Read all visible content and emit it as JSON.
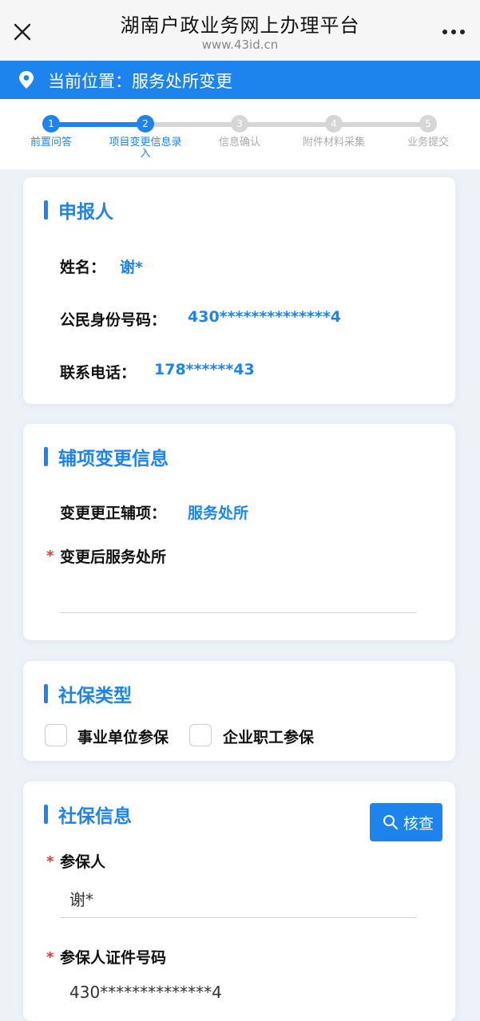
{
  "window": {
    "title": "湖南户政业务网上办理平台",
    "url": "www.43id.cn",
    "close_icon": "close-icon",
    "more_icon": "more-icon"
  },
  "location": {
    "icon": "location-pin-icon",
    "text": "当前位置：服务处所变更"
  },
  "colors": {
    "accent": "#1d84ee",
    "required": "#e53935",
    "inactive": "#d6d6d6"
  },
  "steps": [
    {
      "num": "1",
      "label": "前置问答",
      "active": true
    },
    {
      "num": "2",
      "label": "项目变更信息录入",
      "active": true
    },
    {
      "num": "3",
      "label": "信息确认",
      "active": false
    },
    {
      "num": "4",
      "label": "附件材料采集",
      "active": false
    },
    {
      "num": "5",
      "label": "业务提交",
      "active": false
    }
  ],
  "applicant": {
    "title": "申报人",
    "name_label": "姓名：",
    "name_value": "谢*",
    "id_label": "公民身份号码：",
    "id_value": "430**************4",
    "phone_label": "联系电话：",
    "phone_value": "178******43"
  },
  "aux_change": {
    "title": "辅项变更信息",
    "item_label": "变更更正辅项：",
    "item_value": "服务处所",
    "required_mark": "*",
    "new_address_label": "变更后服务处所",
    "new_address_value": ""
  },
  "insurance_type": {
    "title": "社保类型",
    "options": [
      "事业单位参保",
      "企业职工参保"
    ]
  },
  "insurance_info": {
    "title": "社保信息",
    "check_button": "核查",
    "check_icon": "search-icon",
    "required_mark": "*",
    "insured_label": "参保人",
    "insured_value": "谢*",
    "insured_id_label": "参保人证件号码",
    "insured_id_value": "430**************4"
  }
}
